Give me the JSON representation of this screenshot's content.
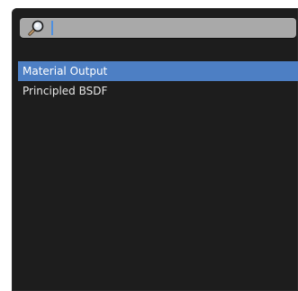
{
  "search": {
    "value": "",
    "placeholder": "",
    "icon": "search-icon"
  },
  "colors": {
    "panel_bg": "#1d1d1d",
    "search_bg": "#a9a9a9",
    "selection": "#4d7fc4",
    "caret": "#4d8fe0"
  },
  "list": {
    "items": [
      {
        "label": "Material Output",
        "selected": true
      },
      {
        "label": "Principled BSDF",
        "selected": false
      }
    ]
  }
}
